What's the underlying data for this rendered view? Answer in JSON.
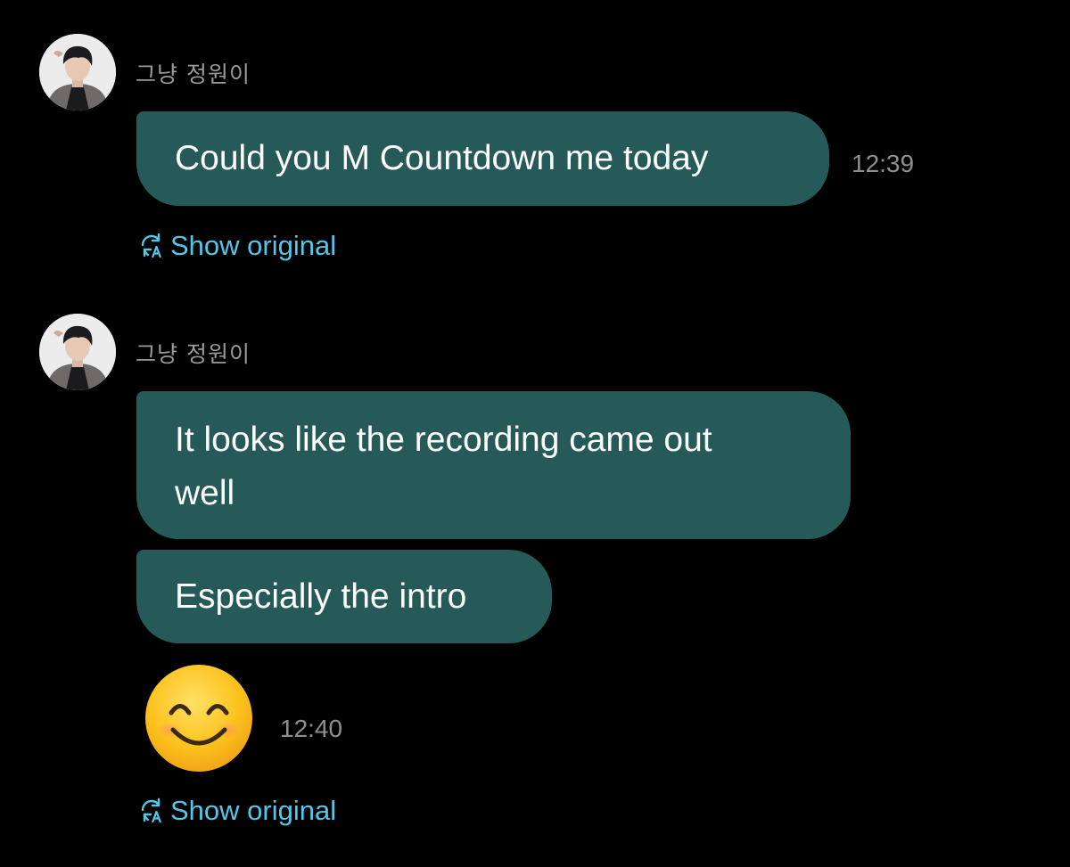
{
  "colors": {
    "background": "#000000",
    "bubble": "#255a59",
    "sender_text": "#9a9a9a",
    "timestamp_text": "#8f8f8f",
    "link_text": "#56c6e8"
  },
  "messages": [
    {
      "sender": "그냥 정원이",
      "avatar_icon": "profile-photo",
      "bubbles": [
        {
          "lines": [
            "Could you M Countdown me today"
          ]
        }
      ],
      "time": "12:39",
      "show_original": "Show original"
    },
    {
      "sender": "그냥 정원이",
      "avatar_icon": "profile-photo",
      "bubbles": [
        {
          "lines": [
            "It looks like the recording came out",
            "well"
          ]
        },
        {
          "lines": [
            "Especially the intro"
          ]
        }
      ],
      "emoji": "smiling-face-with-smiling-eyes",
      "time": "12:40",
      "show_original": "Show original"
    }
  ]
}
